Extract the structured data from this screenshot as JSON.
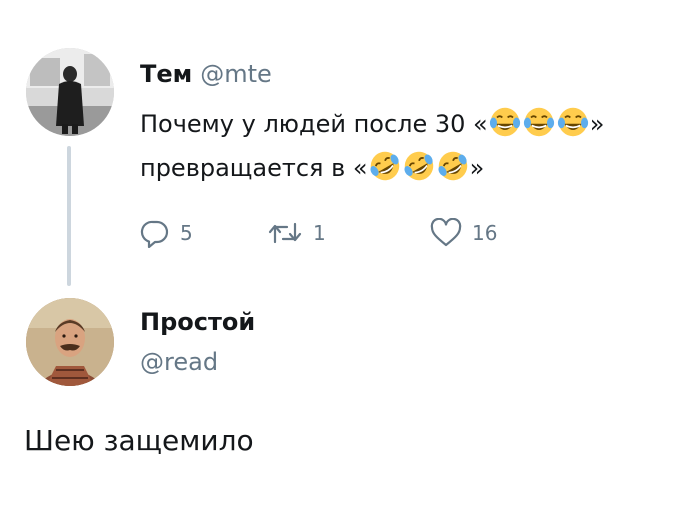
{
  "tweet": {
    "author_name": "Тем",
    "author_handle": "@mte",
    "text_part1": "Почему у людей после 30 «",
    "emoji_joy": [
      "face-with-tears-of-joy",
      "face-with-tears-of-joy",
      "face-with-tears-of-joy"
    ],
    "text_part2": "»",
    "text_part3": "превращается в «",
    "emoji_rofl": [
      "rolling-on-the-floor-laughing",
      "rolling-on-the-floor-laughing",
      "rolling-on-the-floor-laughing"
    ],
    "text_part4": "»",
    "reply_count": "5",
    "retweet_count": "1",
    "like_count": "16"
  },
  "reply": {
    "author_name": "Простой",
    "author_handle": "@read",
    "text": "Шею защемило"
  },
  "colors": {
    "text": "#14171a",
    "secondary": "#657786",
    "thread_line": "#cdd6de",
    "emoji_yellow": "#ffcc4d"
  }
}
